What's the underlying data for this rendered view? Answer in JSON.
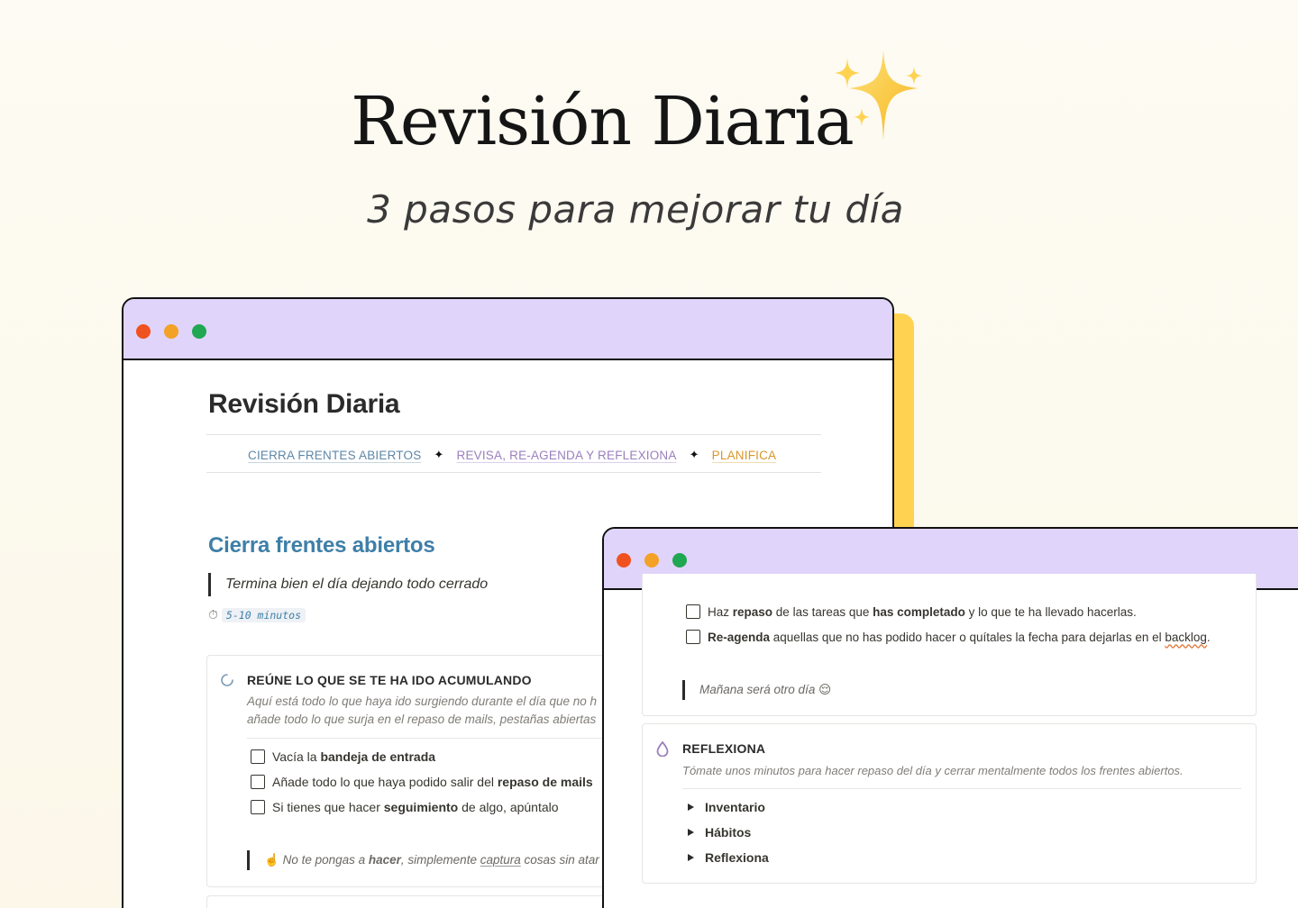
{
  "hero": {
    "title": "Revisión Diaria",
    "subtitle": "3 pasos para mejorar tu día",
    "sparkle_icon": "sparkles-icon"
  },
  "colors": {
    "background": "#fdfbf3",
    "titlebar": "#e0d4fa",
    "accent_yellow": "#ffd351",
    "section_blue": "#3e7fa8",
    "link_purple": "#9b7fbd",
    "link_orange": "#d89628",
    "dot_red": "#f0521f",
    "dot_yellow": "#f3a127",
    "dot_green": "#1fa751"
  },
  "window_a": {
    "page_title": "Revisión Diaria",
    "nav": {
      "link1": "CIERRA FRENTES ABIERTOS",
      "link2": "REVISA, RE-AGENDA Y REFLEXIONA",
      "link3": "PLANIFICA",
      "separator": "✦"
    },
    "section_heading": "Cierra frentes abiertos",
    "quote": "Termina bien el día dejando todo cerrado",
    "timer_icon": "⏱",
    "timer": "5-10 minutos",
    "card": {
      "heading": "REÚNE LO QUE SE TE HA IDO ACUMULANDO",
      "desc1": "Aquí está todo lo que haya ido surgiendo durante el día que no h",
      "desc2": "añade todo lo que surja en el repaso de mails, pestañas abiertas",
      "todos": [
        {
          "pre": "Vacía la ",
          "bold": "bandeja de entrada",
          "post": ""
        },
        {
          "pre": "Añade todo lo que haya podido salir del ",
          "bold": "repaso de mails",
          "post": ""
        },
        {
          "pre": "Si tienes que hacer ",
          "bold": "seguimiento",
          "post": " de algo, apúntalo"
        }
      ],
      "note": {
        "emoji": "☝️",
        "pre": " No te pongas a ",
        "bold": "hacer",
        "mid": ", simplemente ",
        "under": "captura",
        "post": " cosas sin atar"
      }
    }
  },
  "window_b": {
    "todos": [
      {
        "pre": "Haz ",
        "bold": "repaso",
        "mid": " de las tareas que ",
        "bold2": "has completado",
        "post": " y lo que te ha llevado hacerlas."
      },
      {
        "bold": "Re-agenda",
        "mid": " aquellas que no has podido hacer o quítales la fecha para dejarlas en el ",
        "wavy": "backlog",
        "post": "."
      }
    ],
    "note": "Mañana será otro día 😌",
    "card": {
      "heading": "REFLEXIONA",
      "desc": "Tómate unos minutos para hacer repaso del día y cerrar mentalmente todos los frentes abiertos.",
      "toggles": [
        "Inventario",
        "Hábitos",
        "Reflexiona"
      ]
    }
  }
}
